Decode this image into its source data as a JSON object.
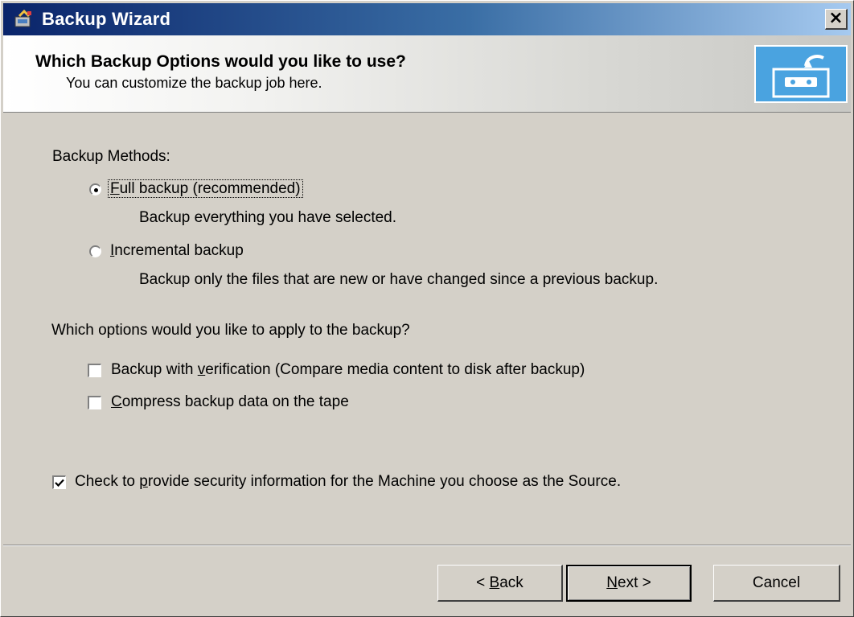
{
  "window": {
    "title": "Backup Wizard",
    "close_label": "×"
  },
  "header": {
    "title": "Which Backup Options would you like to use?",
    "subtitle": "You can customize the backup job here."
  },
  "backup_methods": {
    "heading": "Backup Methods:",
    "options": [
      {
        "accel": "F",
        "rest": "ull backup (recommended)",
        "description": "Backup everything you have selected.",
        "selected": true
      },
      {
        "accel": "I",
        "rest": "ncremental backup",
        "description": "Backup only the files that are new or have changed since a previous backup.",
        "selected": false
      }
    ]
  },
  "apply_options": {
    "heading": "Which options would you like to apply to the backup?",
    "items": [
      {
        "pre": "Backup with ",
        "accel": "v",
        "rest": "erification (Compare media content to disk after backup)",
        "checked": false
      },
      {
        "pre": "",
        "accel": "C",
        "rest": "ompress backup data on the tape",
        "checked": false
      }
    ]
  },
  "security": {
    "pre": "Check to ",
    "accel": "p",
    "rest": "rovide security information for the Machine you choose as the Source.",
    "checked": true
  },
  "buttons": {
    "back": {
      "prefix": "< ",
      "accel": "B",
      "rest": "ack"
    },
    "next": {
      "accel": "N",
      "rest": "ext >"
    },
    "cancel": {
      "label": "Cancel"
    }
  }
}
